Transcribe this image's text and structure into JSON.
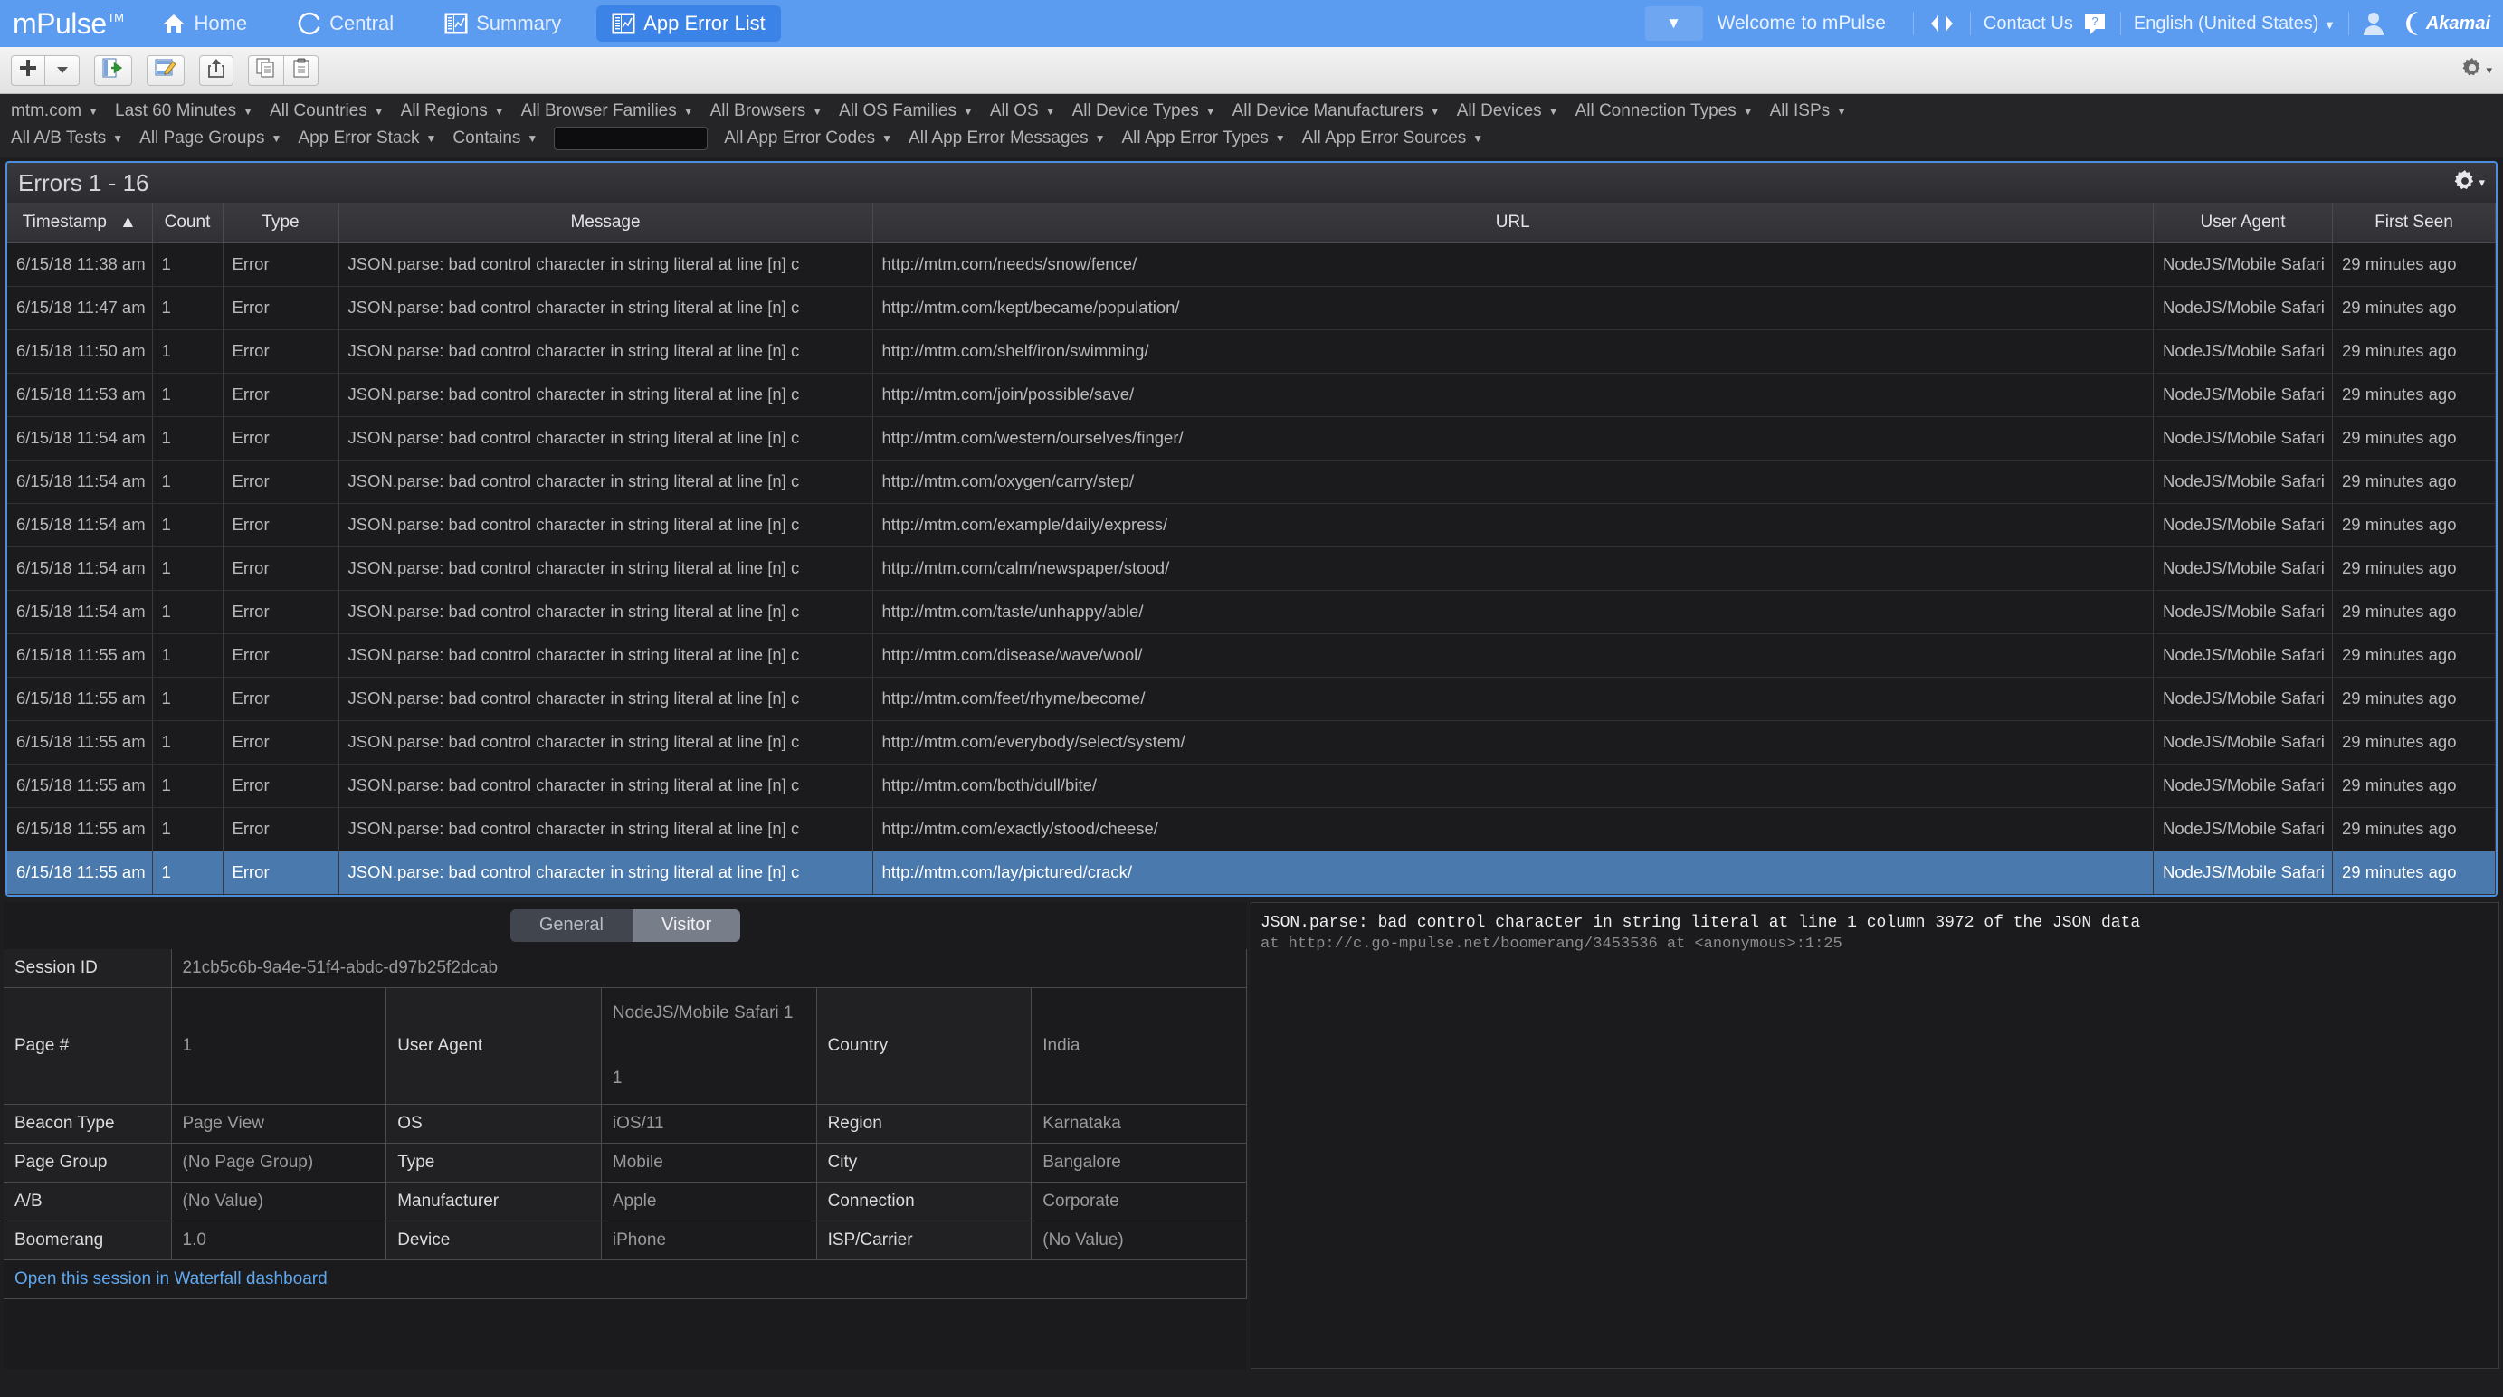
{
  "topnav": {
    "brand": "mPulse",
    "brand_tm": "TM",
    "tabs": [
      {
        "label": "Home",
        "icon": "home-icon",
        "active": false
      },
      {
        "label": "Central",
        "icon": "circle-icon",
        "active": false
      },
      {
        "label": "Summary",
        "icon": "dashboard-icon",
        "active": false
      },
      {
        "label": "App Error List",
        "icon": "dashboard-icon",
        "active": true
      }
    ],
    "chevron": "▼",
    "welcome": "Welcome to mPulse",
    "code_icon": "code-brackets-icon",
    "contact": "Contact Us",
    "help_icon": "help-icon",
    "language": "English (United States)",
    "language_caret": "▼",
    "user_icon": "user-avatar-icon",
    "akamai": "Akamai"
  },
  "toolbar": {
    "buttons": [
      {
        "name": "add-button",
        "icon": "plus-icon"
      },
      {
        "name": "add-dropdown-button",
        "icon": "caret-down-icon"
      },
      {
        "name": "open-dashboard-button",
        "icon": "open-panel-icon"
      },
      {
        "name": "edit-button",
        "icon": "edit-pencil-icon"
      },
      {
        "name": "share-button",
        "icon": "share-upload-icon"
      },
      {
        "name": "copy-button",
        "icon": "copy-icon"
      },
      {
        "name": "paste-button",
        "icon": "clipboard-icon"
      }
    ],
    "settings_icon": "gear-icon",
    "settings_caret": "▾"
  },
  "filters": {
    "row1": [
      {
        "label": "mtm.com",
        "caret": "▼"
      },
      {
        "label": "Last 60 Minutes",
        "caret": "▼"
      },
      {
        "label": "All Countries",
        "caret": "▼"
      },
      {
        "label": "All Regions",
        "caret": "▼"
      },
      {
        "label": "All Browser Families",
        "caret": "▼"
      },
      {
        "label": "All Browsers",
        "caret": "▼"
      },
      {
        "label": "All OS Families",
        "caret": "▼"
      },
      {
        "label": "All OS",
        "caret": "▼"
      },
      {
        "label": "All Device Types",
        "caret": "▼"
      },
      {
        "label": "All Device Manufacturers",
        "caret": "▼"
      },
      {
        "label": "All Devices",
        "caret": "▼"
      },
      {
        "label": "All Connection Types",
        "caret": "▼"
      },
      {
        "label": "All ISPs",
        "caret": "▼"
      }
    ],
    "row2a": [
      {
        "label": "All A/B Tests",
        "caret": "▼"
      },
      {
        "label": "All Page Groups",
        "caret": "▼"
      },
      {
        "label": "App Error Stack",
        "caret": "▼"
      },
      {
        "label": "Contains",
        "caret": "▼"
      }
    ],
    "search_value": "",
    "search_placeholder": "",
    "row2b": [
      {
        "label": "All App Error Codes",
        "caret": "▼"
      },
      {
        "label": "All App Error Messages",
        "caret": "▼"
      },
      {
        "label": "All App Error Types",
        "caret": "▼"
      },
      {
        "label": "All App Error Sources",
        "caret": "▼"
      }
    ]
  },
  "errors_panel": {
    "title": "Errors 1 - 16",
    "gear_icon": "gear-icon",
    "gear_caret": "▾",
    "columns": [
      {
        "key": "timestamp",
        "label": "Timestamp",
        "sort": "▲"
      },
      {
        "key": "count",
        "label": "Count",
        "sort": ""
      },
      {
        "key": "type",
        "label": "Type",
        "sort": ""
      },
      {
        "key": "message",
        "label": "Message",
        "sort": ""
      },
      {
        "key": "url",
        "label": "URL",
        "sort": ""
      },
      {
        "key": "user_agent",
        "label": "User Agent",
        "sort": ""
      },
      {
        "key": "first_seen",
        "label": "First Seen",
        "sort": ""
      }
    ],
    "rows": [
      {
        "timestamp": "6/15/18 11:38 am",
        "count": "1",
        "type": "Error",
        "message": "JSON.parse: bad control character in string literal at line [n] c",
        "url": "http://mtm.com/needs/snow/fence/",
        "user_agent": "NodeJS/Mobile Safari",
        "first_seen": "29 minutes ago",
        "selected": false
      },
      {
        "timestamp": "6/15/18 11:47 am",
        "count": "1",
        "type": "Error",
        "message": "JSON.parse: bad control character in string literal at line [n] c",
        "url": "http://mtm.com/kept/became/population/",
        "user_agent": "NodeJS/Mobile Safari",
        "first_seen": "29 minutes ago",
        "selected": false
      },
      {
        "timestamp": "6/15/18 11:50 am",
        "count": "1",
        "type": "Error",
        "message": "JSON.parse: bad control character in string literal at line [n] c",
        "url": "http://mtm.com/shelf/iron/swimming/",
        "user_agent": "NodeJS/Mobile Safari",
        "first_seen": "29 minutes ago",
        "selected": false
      },
      {
        "timestamp": "6/15/18 11:53 am",
        "count": "1",
        "type": "Error",
        "message": "JSON.parse: bad control character in string literal at line [n] c",
        "url": "http://mtm.com/join/possible/save/",
        "user_agent": "NodeJS/Mobile Safari",
        "first_seen": "29 minutes ago",
        "selected": false
      },
      {
        "timestamp": "6/15/18 11:54 am",
        "count": "1",
        "type": "Error",
        "message": "JSON.parse: bad control character in string literal at line [n] c",
        "url": "http://mtm.com/western/ourselves/finger/",
        "user_agent": "NodeJS/Mobile Safari",
        "first_seen": "29 minutes ago",
        "selected": false
      },
      {
        "timestamp": "6/15/18 11:54 am",
        "count": "1",
        "type": "Error",
        "message": "JSON.parse: bad control character in string literal at line [n] c",
        "url": "http://mtm.com/oxygen/carry/step/",
        "user_agent": "NodeJS/Mobile Safari",
        "first_seen": "29 minutes ago",
        "selected": false
      },
      {
        "timestamp": "6/15/18 11:54 am",
        "count": "1",
        "type": "Error",
        "message": "JSON.parse: bad control character in string literal at line [n] c",
        "url": "http://mtm.com/example/daily/express/",
        "user_agent": "NodeJS/Mobile Safari",
        "first_seen": "29 minutes ago",
        "selected": false
      },
      {
        "timestamp": "6/15/18 11:54 am",
        "count": "1",
        "type": "Error",
        "message": "JSON.parse: bad control character in string literal at line [n] c",
        "url": "http://mtm.com/calm/newspaper/stood/",
        "user_agent": "NodeJS/Mobile Safari",
        "first_seen": "29 minutes ago",
        "selected": false
      },
      {
        "timestamp": "6/15/18 11:54 am",
        "count": "1",
        "type": "Error",
        "message": "JSON.parse: bad control character in string literal at line [n] c",
        "url": "http://mtm.com/taste/unhappy/able/",
        "user_agent": "NodeJS/Mobile Safari",
        "first_seen": "29 minutes ago",
        "selected": false
      },
      {
        "timestamp": "6/15/18 11:55 am",
        "count": "1",
        "type": "Error",
        "message": "JSON.parse: bad control character in string literal at line [n] c",
        "url": "http://mtm.com/disease/wave/wool/",
        "user_agent": "NodeJS/Mobile Safari",
        "first_seen": "29 minutes ago",
        "selected": false
      },
      {
        "timestamp": "6/15/18 11:55 am",
        "count": "1",
        "type": "Error",
        "message": "JSON.parse: bad control character in string literal at line [n] c",
        "url": "http://mtm.com/feet/rhyme/become/",
        "user_agent": "NodeJS/Mobile Safari",
        "first_seen": "29 minutes ago",
        "selected": false
      },
      {
        "timestamp": "6/15/18 11:55 am",
        "count": "1",
        "type": "Error",
        "message": "JSON.parse: bad control character in string literal at line [n] c",
        "url": "http://mtm.com/everybody/select/system/",
        "user_agent": "NodeJS/Mobile Safari",
        "first_seen": "29 minutes ago",
        "selected": false
      },
      {
        "timestamp": "6/15/18 11:55 am",
        "count": "1",
        "type": "Error",
        "message": "JSON.parse: bad control character in string literal at line [n] c",
        "url": "http://mtm.com/both/dull/bite/",
        "user_agent": "NodeJS/Mobile Safari",
        "first_seen": "29 minutes ago",
        "selected": false
      },
      {
        "timestamp": "6/15/18 11:55 am",
        "count": "1",
        "type": "Error",
        "message": "JSON.parse: bad control character in string literal at line [n] c",
        "url": "http://mtm.com/exactly/stood/cheese/",
        "user_agent": "NodeJS/Mobile Safari",
        "first_seen": "29 minutes ago",
        "selected": false
      },
      {
        "timestamp": "6/15/18 11:55 am",
        "count": "1",
        "type": "Error",
        "message": "JSON.parse: bad control character in string literal at line [n] c",
        "url": "http://mtm.com/lay/pictured/crack/",
        "user_agent": "NodeJS/Mobile Safari",
        "first_seen": "29 minutes ago",
        "selected": true
      }
    ]
  },
  "details": {
    "tabs": [
      {
        "label": "General",
        "active": false
      },
      {
        "label": "Visitor",
        "active": true
      }
    ],
    "session_id_label": "Session ID",
    "session_id_value": "21cb5c6b-9a4e-51f4-abdc-d97b25f2dcab",
    "rows": [
      {
        "k1": "Page #",
        "v1": "1",
        "k2": "User Agent",
        "v2": "NodeJS/Mobile Safari 1\n\n1",
        "k3": "Country",
        "v3": "India"
      },
      {
        "k1": "Beacon Type",
        "v1": "Page View",
        "k2": "OS",
        "v2": "iOS/11",
        "k3": "Region",
        "v3": "Karnataka"
      },
      {
        "k1": "Page Group",
        "v1": "(No Page Group)",
        "k2": "Type",
        "v2": "Mobile",
        "k3": "City",
        "v3": "Bangalore"
      },
      {
        "k1": "A/B",
        "v1": "(No Value)",
        "k2": "Manufacturer",
        "v2": "Apple",
        "k3": "Connection",
        "v3": "Corporate"
      },
      {
        "k1": "Boomerang",
        "v1": "1.0",
        "k2": "Device",
        "v2": "iPhone",
        "k3": "ISP/Carrier",
        "v3": "(No Value)"
      }
    ],
    "waterfall_link": "Open this session in Waterfall dashboard"
  },
  "stack": {
    "message": "JSON.parse: bad control character in string literal at line 1 column 3972 of the JSON data",
    "trace": "at http://c.go-mpulse.net/boomerang/3453536 at <anonymous>:1:25"
  },
  "colors": {
    "nav_blue": "#5b9bf0",
    "active_tab": "#3c83e8",
    "panel_border": "#4a8fe0",
    "selected_row": "#4a79ad",
    "link_blue": "#5fa8ef",
    "bg_dark": "#1e1e20"
  }
}
